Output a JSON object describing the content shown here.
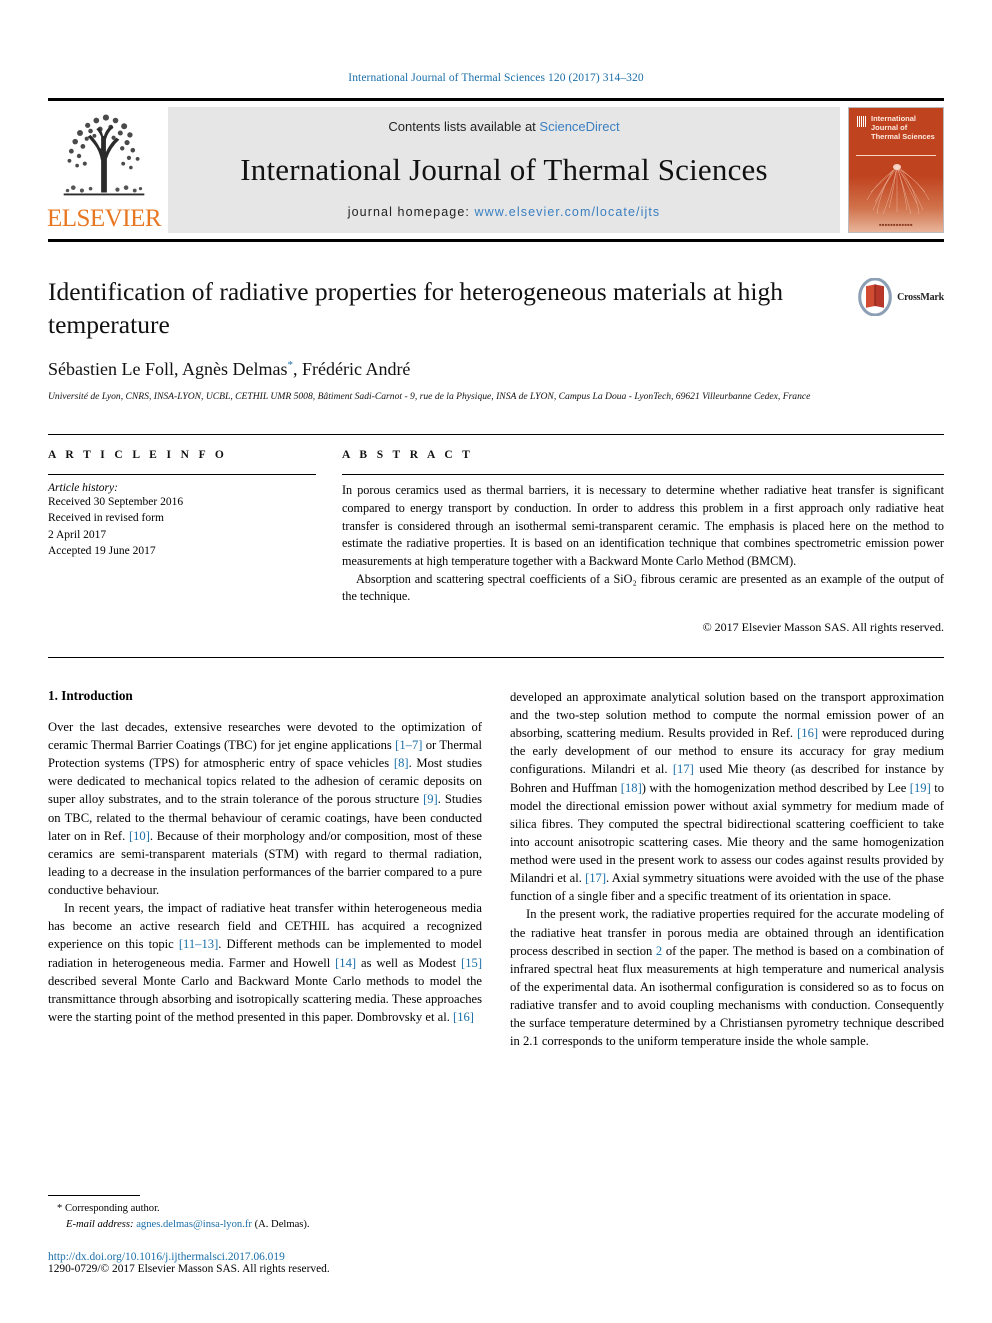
{
  "running_head": "International Journal of Thermal Sciences 120 (2017) 314–320",
  "masthead": {
    "contents_prefix": "Contents lists available at ",
    "sciencedirect": "ScienceDirect",
    "journal_title": "International Journal of Thermal Sciences",
    "homepage_label": "journal homepage: ",
    "homepage_url": "www.elsevier.com/locate/ijts",
    "publisher": "ELSEVIER",
    "cover_title": "International Journal of Thermal Sciences",
    "accent_orange": "#E87722",
    "link_blue": "#3a7fc1",
    "band_gray": "#e6e6e6",
    "cover_red": "#c0431f"
  },
  "article": {
    "title": "Identification of radiative properties for heterogeneous materials at high temperature",
    "authors": "Sébastien Le Foll, Agnès Delmas",
    "authors_tail": ", Frédéric André",
    "corresponding_marker": "*",
    "affiliation": "Université de Lyon, CNRS, INSA-LYON, UCBL, CETHIL UMR 5008, Bâtiment Sadi-Carnot - 9, rue de la Physique, INSA de LYON, Campus La Doua - LyonTech, 69621 Villeurbanne Cedex, France",
    "crossmark_label": "CrossMark"
  },
  "article_info": {
    "heading": "A R T I C L E  I N F O",
    "history_label": "Article history:",
    "history": [
      "Received 30 September 2016",
      "Received in revised form",
      "2 April 2017",
      "Accepted 19 June 2017"
    ]
  },
  "abstract": {
    "heading": "A B S T R A C T",
    "paragraph_1": "In porous ceramics used as thermal barriers, it is necessary to determine whether radiative heat transfer is significant compared to energy transport by conduction. In order to address this problem in a first approach only radiative heat transfer is considered through an isothermal semi-transparent ceramic. The emphasis is placed here on the method to estimate the radiative properties. It is based on an identification technique that combines spectrometric emission power measurements at high temperature together with a Backward Monte Carlo Method (BMCM).",
    "paragraph_2": "Absorption and scattering spectral coefficients of a SiO₂ fibrous ceramic are presented as an example of the output of the technique.",
    "copyright": "© 2017 Elsevier Masson SAS. All rights reserved."
  },
  "body": {
    "section_number_title": "1.  Introduction",
    "left_paragraphs": [
      "Over the last decades, extensive researches were devoted to the optimization of ceramic Thermal Barrier Coatings (TBC) for jet engine applications [1–7] or Thermal Protection systems (TPS) for atmospheric entry of space vehicles [8]. Most studies were dedicated to mechanical topics related to the adhesion of ceramic deposits on super alloy substrates, and to the strain tolerance of the porous structure [9]. Studies on TBC, related to the thermal behaviour of ceramic coatings, have been conducted later on in Ref. [10]. Because of their morphology and/or composition, most of these ceramics are semi-transparent materials (STM) with regard to thermal radiation, leading to a decrease in the insulation performances of the barrier compared to a pure conductive behaviour.",
      "In recent years, the impact of radiative heat transfer within heterogeneous media has become an active research field and CETHIL has acquired a recognized experience on this topic [11–13]. Different methods can be implemented to model radiation in heterogeneous media. Farmer and Howell [14] as well as Modest [15] described several Monte Carlo and Backward Monte Carlo methods to model the transmittance through absorbing and isotropically scattering media. These approaches were the starting point of the method presented in this paper. Dombrovsky et al. [16]"
    ],
    "right_paragraphs": [
      "developed an approximate analytical solution based on the transport approximation and the two-step solution method to compute the normal emission power of an absorbing, scattering medium. Results provided in Ref. [16] were reproduced during the early development of our method to ensure its accuracy for gray medium configurations. Milandri et al. [17] used Mie theory (as described for instance by Bohren and Huffman [18]) with the homogenization method described by Lee [19] to model the directional emission power without axial symmetry for medium made of silica fibres. They computed the spectral bidirectional scattering coefficient to take into account anisotropic scattering cases. Mie theory and the same homogenization method were used in the present work to assess our codes against results provided by Milandri et al. [17]. Axial symmetry situations were avoided with the use of the phase function of a single fiber and a specific treatment of its orientation in space.",
      "In the present work, the radiative properties required for the accurate modeling of the radiative heat transfer in porous media are obtained through an identification process described in section 2 of the paper. The method is based on a combination of infrared spectral heat flux measurements at high temperature and numerical analysis of the experimental data. An isothermal configuration is considered so as to focus on radiative transfer and to avoid coupling mechanisms with conduction. Consequently the surface temperature determined by a Christiansen pyrometry technique described in 2.1 corresponds to the uniform temperature inside the whole sample."
    ]
  },
  "footer": {
    "corresponding_marker": "*",
    "corresponding_label": "Corresponding author.",
    "email_label": "E-mail address:",
    "email": "agnes.delmas@insa-lyon.fr",
    "email_suffix": "(A. Delmas).",
    "doi": "http://dx.doi.org/10.1016/j.ijthermalsci.2017.06.019",
    "issn_line": "1290-0729/© 2017 Elsevier Masson SAS. All rights reserved."
  }
}
